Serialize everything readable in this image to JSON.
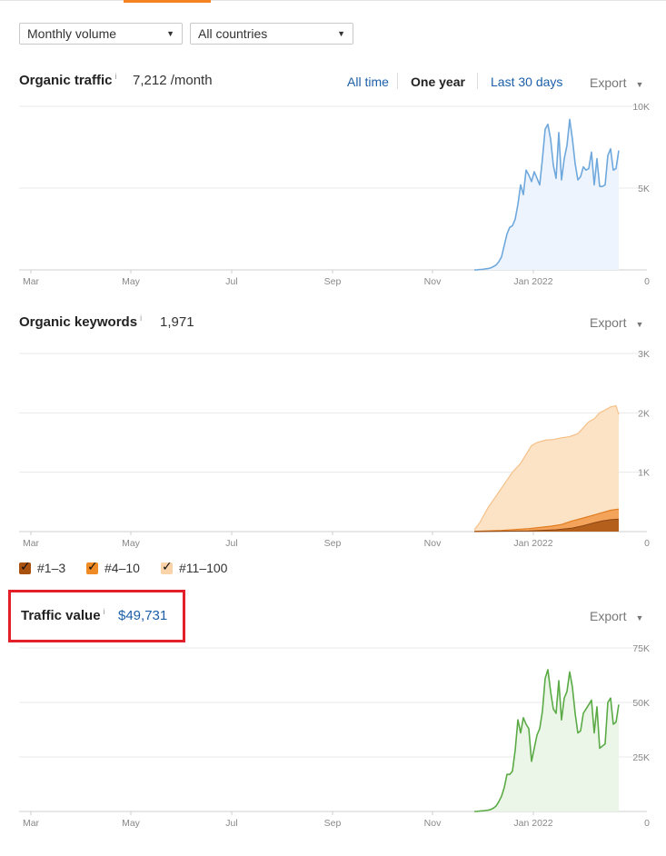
{
  "filters": {
    "volume": "Monthly volume",
    "country": "All countries"
  },
  "organic_traffic": {
    "title": "Organic traffic",
    "info": "i",
    "value": "7,212 /month",
    "ranges": [
      "All time",
      "One year",
      "Last 30 days"
    ],
    "active_range": "One year",
    "export": "Export"
  },
  "organic_keywords": {
    "title": "Organic keywords",
    "info": "i",
    "value": "1,971",
    "export": "Export",
    "legend": [
      {
        "label": "#1–3",
        "color": "#a9510f",
        "checked": true
      },
      {
        "label": "#4–10",
        "color": "#f08a24",
        "checked": true
      },
      {
        "label": "#11–100",
        "color": "#fbd3a9",
        "checked": true
      }
    ]
  },
  "traffic_value": {
    "title": "Traffic value",
    "info": "i",
    "value": "$49,731",
    "export": "Export"
  },
  "colors": {
    "accent": "#f58220",
    "link": "#1c5fa8",
    "traffic": "#6fa8dc",
    "value": "#5aaa46",
    "highlight": "#e3202a"
  },
  "chart_data": [
    {
      "type": "area",
      "title": "Organic traffic",
      "x_ticks": [
        "Mar",
        "May",
        "Jul",
        "Sep",
        "Nov",
        "Jan 2022"
      ],
      "y_ticks": [
        "10K",
        "5K",
        "0"
      ],
      "ylim": [
        0,
        10000
      ],
      "grid": true,
      "series": [
        {
          "values": [
            [
              0,
              0
            ],
            [
              1,
              0
            ],
            [
              2,
              20
            ],
            [
              3,
              30
            ],
            [
              4,
              60
            ],
            [
              5,
              80
            ],
            [
              6,
              120
            ],
            [
              7,
              200
            ],
            [
              8,
              300
            ],
            [
              9,
              500
            ],
            [
              10,
              800
            ],
            [
              11,
              1500
            ],
            [
              12,
              2200
            ],
            [
              13,
              2600
            ],
            [
              14,
              2700
            ],
            [
              15,
              3100
            ],
            [
              16,
              4000
            ],
            [
              17,
              5200
            ],
            [
              18,
              4600
            ],
            [
              19,
              6100
            ],
            [
              20,
              5800
            ],
            [
              21,
              5400
            ],
            [
              22,
              6000
            ],
            [
              23,
              5600
            ],
            [
              24,
              5200
            ],
            [
              25,
              6800
            ],
            [
              26,
              8600
            ],
            [
              27,
              8900
            ],
            [
              28,
              8000
            ],
            [
              29,
              6400
            ],
            [
              30,
              5600
            ],
            [
              31,
              8400
            ],
            [
              32,
              5500
            ],
            [
              33,
              6800
            ],
            [
              34,
              7600
            ],
            [
              35,
              9200
            ],
            [
              36,
              8000
            ],
            [
              37,
              6500
            ],
            [
              38,
              5500
            ],
            [
              39,
              5700
            ],
            [
              40,
              6300
            ],
            [
              41,
              6100
            ],
            [
              42,
              6200
            ],
            [
              43,
              7200
            ],
            [
              44,
              5200
            ],
            [
              45,
              6800
            ],
            [
              46,
              5100
            ],
            [
              47,
              5100
            ],
            [
              48,
              5200
            ],
            [
              49,
              7000
            ],
            [
              50,
              7400
            ],
            [
              51,
              6100
            ],
            [
              52,
              6200
            ],
            [
              53,
              7300
            ]
          ]
        }
      ]
    },
    {
      "type": "area",
      "title": "Organic keywords",
      "x_ticks": [
        "Mar",
        "May",
        "Jul",
        "Sep",
        "Nov",
        "Jan 2022"
      ],
      "y_ticks": [
        "3K",
        "2K",
        "1K",
        "0"
      ],
      "ylim": [
        0,
        3000
      ],
      "grid": true,
      "series": [
        {
          "name": "#11–100",
          "values": [
            [
              0,
              30
            ],
            [
              2,
              150
            ],
            [
              5,
              400
            ],
            [
              8,
              600
            ],
            [
              11,
              800
            ],
            [
              14,
              1000
            ],
            [
              17,
              1150
            ],
            [
              19,
              1300
            ],
            [
              21,
              1450
            ],
            [
              23,
              1500
            ],
            [
              26,
              1540
            ],
            [
              29,
              1550
            ],
            [
              32,
              1580
            ],
            [
              35,
              1600
            ],
            [
              38,
              1650
            ],
            [
              40,
              1750
            ],
            [
              42,
              1850
            ],
            [
              44,
              1900
            ],
            [
              46,
              2000
            ],
            [
              48,
              2050
            ],
            [
              50,
              2100
            ],
            [
              52,
              2120
            ],
            [
              53,
              1971
            ]
          ]
        },
        {
          "name": "#4–10",
          "values": [
            [
              0,
              5
            ],
            [
              10,
              20
            ],
            [
              20,
              50
            ],
            [
              28,
              90
            ],
            [
              32,
              120
            ],
            [
              36,
              180
            ],
            [
              40,
              230
            ],
            [
              44,
              280
            ],
            [
              47,
              320
            ],
            [
              50,
              360
            ],
            [
              53,
              380
            ]
          ]
        },
        {
          "name": "#1–3",
          "values": [
            [
              0,
              0
            ],
            [
              20,
              10
            ],
            [
              30,
              30
            ],
            [
              36,
              60
            ],
            [
              40,
              100
            ],
            [
              44,
              150
            ],
            [
              47,
              180
            ],
            [
              50,
              200
            ],
            [
              53,
              210
            ]
          ]
        }
      ]
    },
    {
      "type": "area",
      "title": "Traffic value",
      "x_ticks": [
        "Mar",
        "May",
        "Jul",
        "Sep",
        "Nov",
        "Jan 2022"
      ],
      "y_ticks": [
        "75K",
        "50K",
        "25K",
        "0"
      ],
      "ylim": [
        0,
        75000
      ],
      "grid": true,
      "series": [
        {
          "values": [
            [
              0,
              0
            ],
            [
              1,
              0
            ],
            [
              2,
              200
            ],
            [
              3,
              300
            ],
            [
              4,
              400
            ],
            [
              5,
              600
            ],
            [
              6,
              900
            ],
            [
              7,
              1500
            ],
            [
              8,
              2500
            ],
            [
              9,
              4500
            ],
            [
              10,
              7000
            ],
            [
              11,
              11000
            ],
            [
              12,
              17000
            ],
            [
              13,
              17000
            ],
            [
              14,
              18500
            ],
            [
              15,
              28000
            ],
            [
              16,
              42000
            ],
            [
              17,
              36000
            ],
            [
              18,
              43000
            ],
            [
              19,
              40000
            ],
            [
              20,
              38000
            ],
            [
              21,
              23000
            ],
            [
              22,
              29000
            ],
            [
              23,
              35000
            ],
            [
              24,
              38000
            ],
            [
              25,
              46000
            ],
            [
              26,
              61000
            ],
            [
              27,
              65000
            ],
            [
              28,
              55000
            ],
            [
              29,
              47000
            ],
            [
              30,
              45000
            ],
            [
              31,
              60000
            ],
            [
              32,
              42000
            ],
            [
              33,
              52000
            ],
            [
              34,
              55000
            ],
            [
              35,
              64000
            ],
            [
              36,
              57000
            ],
            [
              37,
              45000
            ],
            [
              38,
              36000
            ],
            [
              39,
              37000
            ],
            [
              40,
              45000
            ],
            [
              41,
              47000
            ],
            [
              42,
              49000
            ],
            [
              43,
              51000
            ],
            [
              44,
              36000
            ],
            [
              45,
              48000
            ],
            [
              46,
              29000
            ],
            [
              47,
              30000
            ],
            [
              48,
              31000
            ],
            [
              49,
              50000
            ],
            [
              50,
              52000
            ],
            [
              51,
              40000
            ],
            [
              52,
              41000
            ],
            [
              53,
              49000
            ]
          ]
        }
      ]
    }
  ]
}
